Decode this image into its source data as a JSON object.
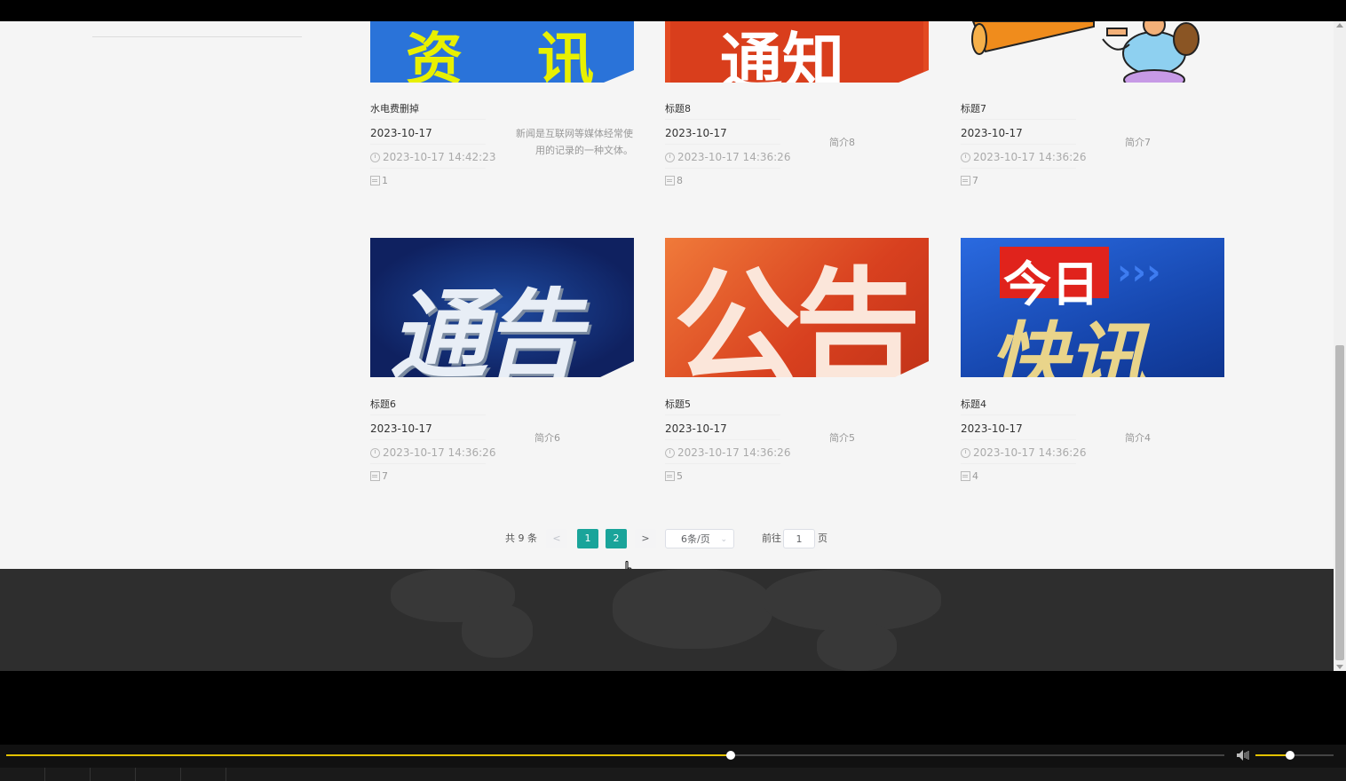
{
  "articles": [
    {
      "title": "水电费删掉",
      "date": "2023-10-17",
      "time": "2023-10-17 14:42:23",
      "count": "1",
      "intro": "新闻是互联网等媒体经常使用的记录的一种文体。",
      "image_text": "资  讯",
      "image_bg": "#2a73d9",
      "image_fg": "#e8f000"
    },
    {
      "title": "标题8",
      "date": "2023-10-17",
      "time": "2023-10-17 14:36:26",
      "count": "8",
      "intro": "简介8",
      "image_text": "通知",
      "image_bg": "#e34a22",
      "image_fg": "#ffffff"
    },
    {
      "title": "标题7",
      "date": "2023-10-17",
      "time": "2023-10-17 14:36:26",
      "count": "7",
      "intro": "简介7",
      "image_text": "",
      "image_bg": "#f5f5f5",
      "image_fg": "#f08c1c"
    },
    {
      "title": "标题6",
      "date": "2023-10-17",
      "time": "2023-10-17 14:36:26",
      "count": "7",
      "intro": "简介6",
      "image_text": "通告",
      "image_bg": "#13286e",
      "image_fg": "#e8eef6"
    },
    {
      "title": "标题5",
      "date": "2023-10-17",
      "time": "2023-10-17 14:36:26",
      "count": "5",
      "intro": "简介5",
      "image_text": "公告",
      "image_bg": "#e3522a",
      "image_fg": "#fbe6da"
    },
    {
      "title": "标题4",
      "date": "2023-10-17",
      "time": "2023-10-17 14:36:26",
      "count": "4",
      "intro": "简介4",
      "image_text": "快讯",
      "image_text_top": "今日",
      "image_bg": "#1a55c8",
      "image_fg": "#e9d48a"
    }
  ],
  "pagination": {
    "total_label": "共 9 条",
    "prev": "<",
    "pages": [
      "1",
      "2"
    ],
    "current_page": "2",
    "next": ">",
    "page_size": "6条/页",
    "goto_label": "前往",
    "goto_value": "1",
    "goto_suffix": "页"
  },
  "player": {
    "progress": 0.595,
    "volume": 0.44,
    "accent_color": "#e3c200"
  },
  "colors": {
    "page_bg": "#f5f5f5",
    "active_page": "#1aa49a",
    "footer_bg": "#2e2e2e"
  },
  "icons": [
    "clock-icon",
    "document-icon",
    "speaker-icon",
    "mouse-pointer-icon"
  ]
}
